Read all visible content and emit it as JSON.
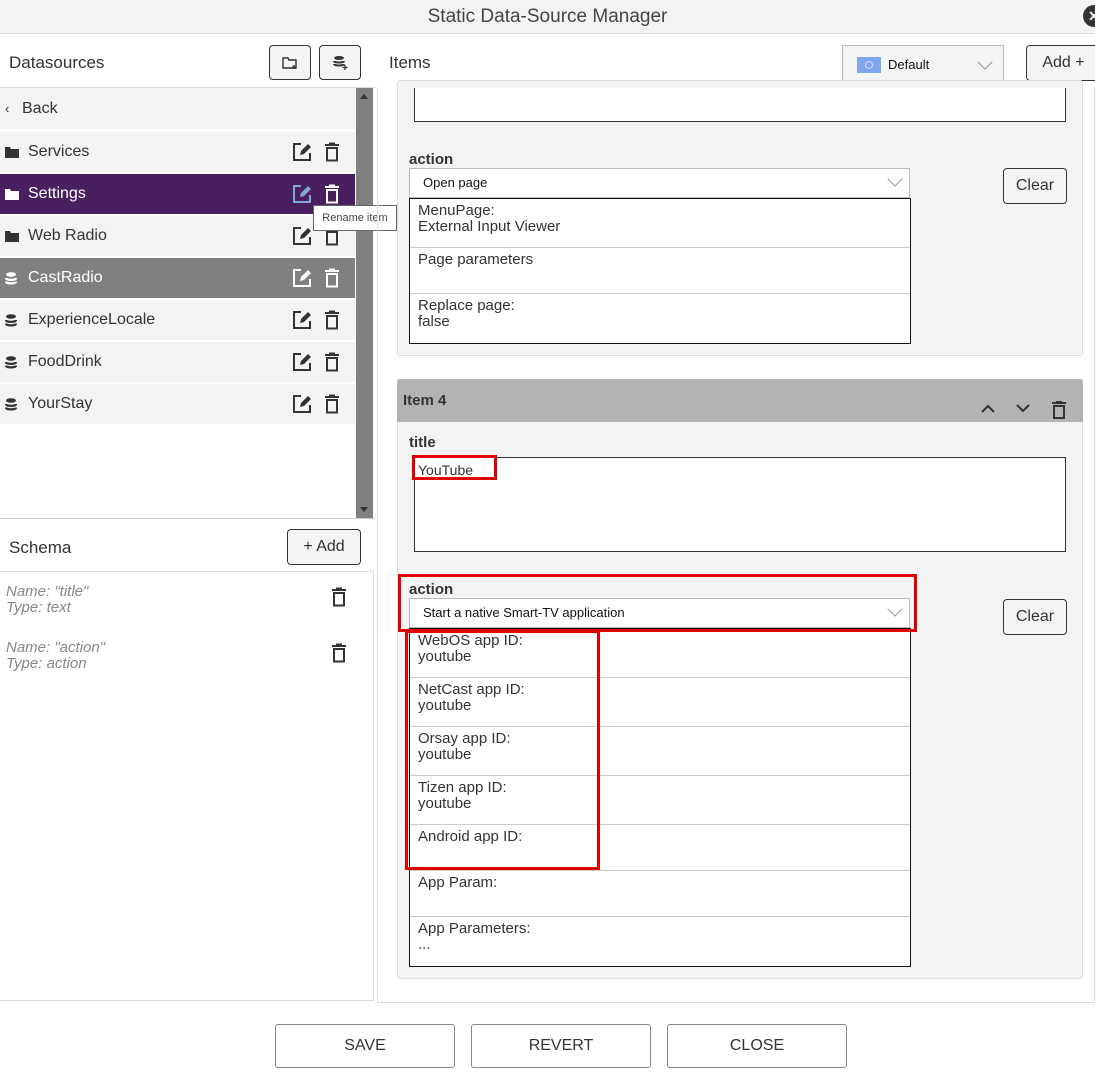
{
  "window": {
    "title": "Static Data-Source Manager"
  },
  "left": {
    "header": "Datasources",
    "back": "Back",
    "items": [
      {
        "label": "Services",
        "icon": "folder-icon",
        "state": "normal"
      },
      {
        "label": "Settings",
        "icon": "folder-icon",
        "state": "selected"
      },
      {
        "label": "Web Radio",
        "icon": "folder-icon",
        "state": "normal"
      },
      {
        "label": "CastRadio",
        "icon": "database-icon",
        "state": "active"
      },
      {
        "label": "ExperienceLocale",
        "icon": "database-icon",
        "state": "normal"
      },
      {
        "label": "FoodDrink",
        "icon": "database-icon",
        "state": "normal"
      },
      {
        "label": "YourStay",
        "icon": "database-icon",
        "state": "normal"
      }
    ],
    "tooltip": "Rename item",
    "schema": {
      "header": "Schema",
      "add": "+ Add",
      "items": [
        {
          "name": "Name: \"title\"",
          "type": "Type: text"
        },
        {
          "name": "Name: \"action\"",
          "type": "Type: action"
        }
      ]
    }
  },
  "right": {
    "header": "Items",
    "locale": "Default",
    "add": "Add +",
    "item3": {
      "action_label": "action",
      "action_value": "Open page",
      "clear": "Clear",
      "options": [
        [
          "MenuPage:",
          "External Input Viewer"
        ],
        [
          "Page parameters",
          ""
        ],
        [
          "Replace page:",
          "false"
        ]
      ]
    },
    "item4": {
      "header": "Item 4",
      "title_label": "title",
      "title_value": "YouTube",
      "action_label": "action",
      "action_value": "Start a native Smart-TV application",
      "clear": "Clear",
      "options": [
        [
          "WebOS app ID:",
          "youtube"
        ],
        [
          "NetCast app ID:",
          "youtube"
        ],
        [
          "Orsay app ID:",
          "youtube"
        ],
        [
          "Tizen app ID:",
          "youtube"
        ],
        [
          "Android app ID:",
          ""
        ],
        [
          "App Param:",
          ""
        ],
        [
          "App Parameters:",
          "..."
        ]
      ]
    }
  },
  "footer": {
    "save": "SAVE",
    "revert": "REVERT",
    "close": "CLOSE"
  },
  "colors": {
    "selected": "#4a1f5f",
    "active": "#808080",
    "highlight": "#e00000"
  }
}
